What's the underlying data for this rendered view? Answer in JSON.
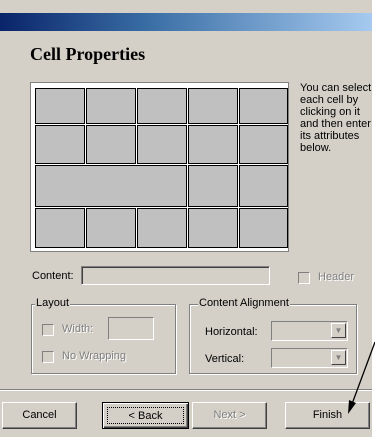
{
  "dialog": {
    "heading": "Cell Properties",
    "instructions": "You can select each cell by clicking on it and then enter its attributes below."
  },
  "content": {
    "label": "Content:",
    "value": "",
    "header_checkbox_label": "Header",
    "header_checked": false
  },
  "layout": {
    "legend": "Layout",
    "width_label": "Width:",
    "width_value": "",
    "no_wrapping_label": "No Wrapping",
    "width_checked": false,
    "no_wrapping_checked": false
  },
  "alignment": {
    "legend": "Content Alignment",
    "horizontal_label": "Horizontal:",
    "horizontal_value": "",
    "vertical_label": "Vertical:",
    "vertical_value": ""
  },
  "buttons": {
    "cancel": "Cancel",
    "back": "< Back",
    "next": "Next >",
    "finish": "Finish"
  },
  "colors": {
    "dialog_face": "#d4d0c8",
    "titlebar_start": "#0a246a",
    "titlebar_end": "#a6caf0",
    "cell_fill": "#c0c0c0",
    "disabled_text": "#808080"
  },
  "grid": {
    "rows": [
      [
        1,
        1,
        1,
        1,
        1
      ],
      [
        1,
        1,
        1,
        1,
        1
      ],
      [
        3,
        1,
        1
      ],
      [
        1,
        1,
        1,
        1,
        1
      ]
    ]
  }
}
